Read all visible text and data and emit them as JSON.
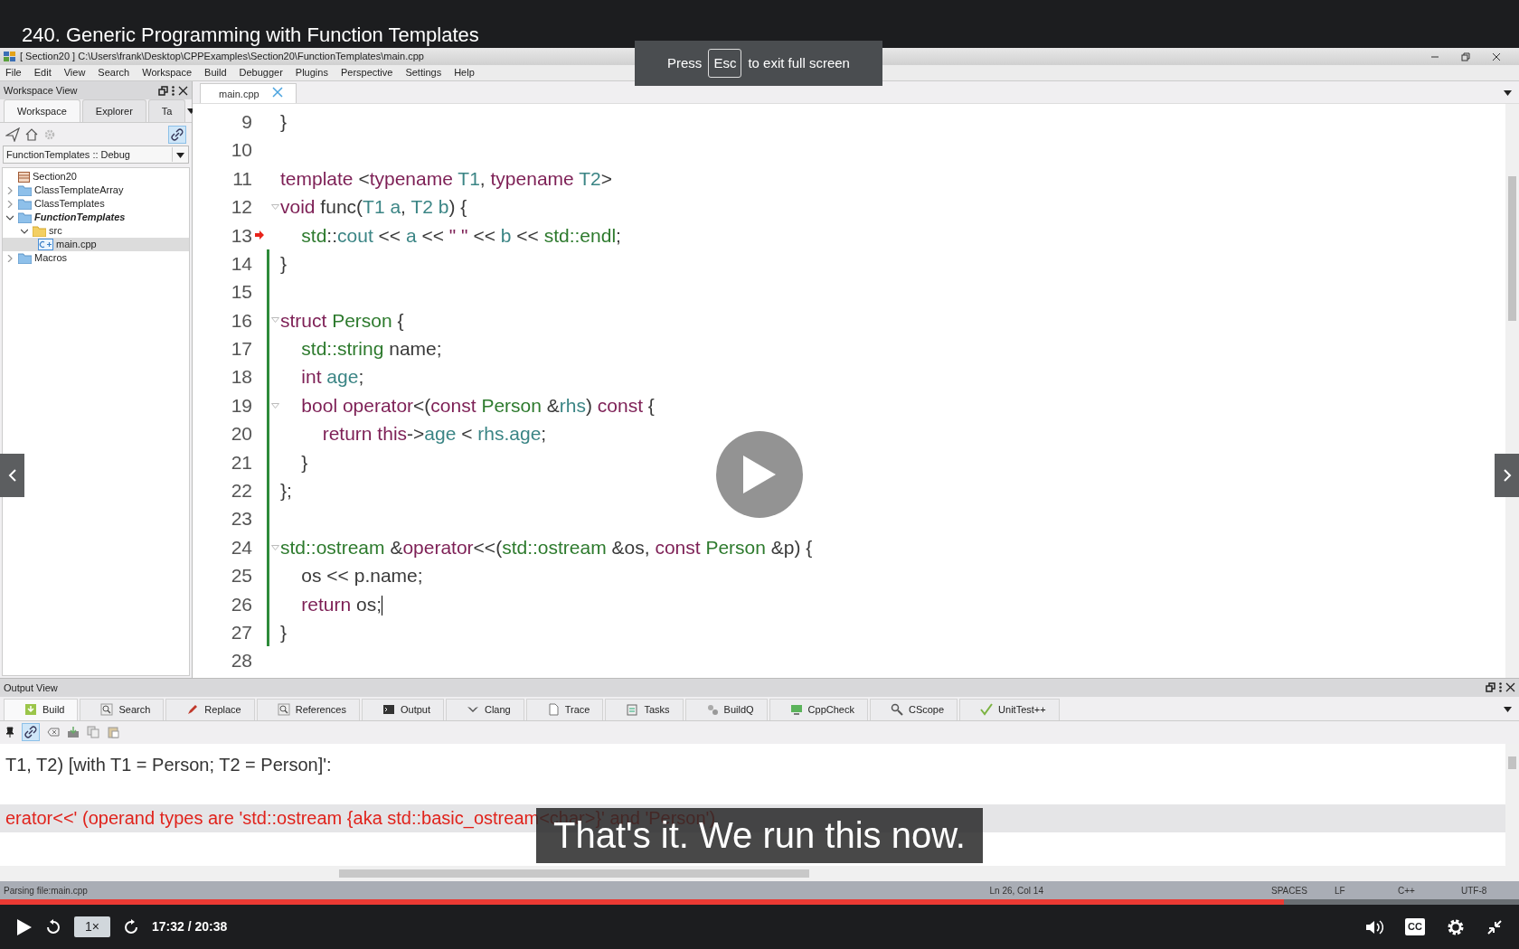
{
  "video": {
    "title": "240. Generic Programming with Function Templates",
    "toast": {
      "before": "Press",
      "key": "Esc",
      "after": "to exit full screen"
    },
    "subtitle": "That's it. We run this now.",
    "progress": {
      "level": 0.845
    },
    "speed": "1×",
    "time": "17:32 / 20:38",
    "captions": "CC"
  },
  "ide": {
    "title": "[ Section20 ] C:\\Users\\frank\\Desktop\\CPPExamples\\Section20\\FunctionTemplates\\main.cpp",
    "menu": [
      "File",
      "Edit",
      "View",
      "Search",
      "Workspace",
      "Build",
      "Debugger",
      "Plugins",
      "Perspective",
      "Settings",
      "Help"
    ],
    "workspace": {
      "title": "Workspace View",
      "tabs": [
        {
          "label": "Workspace",
          "selected": true
        },
        {
          "label": "Explorer",
          "selected": false
        },
        {
          "label": "Ta",
          "selected": false
        }
      ],
      "link_active": true,
      "configuration": "FunctionTemplates :: Debug",
      "tree": [
        {
          "label": "Section20",
          "kind": "workspace",
          "selected": false,
          "active": false,
          "children": [
            {
              "label": "ClassTemplateArray",
              "kind": "project",
              "expanded": false,
              "selected": false,
              "active": false
            },
            {
              "label": "ClassTemplates",
              "kind": "project",
              "expanded": false,
              "selected": false,
              "active": false
            },
            {
              "label": "FunctionTemplates",
              "kind": "project",
              "expanded": true,
              "selected": false,
              "active": true,
              "children": [
                {
                  "label": "src",
                  "kind": "folder",
                  "expanded": true,
                  "selected": false,
                  "active": false,
                  "children": [
                    {
                      "label": "main.cpp",
                      "kind": "file",
                      "selected": true,
                      "active": false
                    }
                  ]
                }
              ]
            },
            {
              "label": "Macros",
              "kind": "project",
              "expanded": false,
              "selected": false,
              "active": false
            }
          ]
        }
      ]
    },
    "editor": {
      "tabs": [
        {
          "label": "main.cpp",
          "selected": true
        }
      ],
      "lines": [
        {
          "number": "9",
          "fold": false,
          "marker": false,
          "modified": false,
          "caret": false,
          "tokens": [
            {
              "t": "}",
              "kind": "p"
            }
          ]
        },
        {
          "number": "10",
          "fold": false,
          "marker": false,
          "modified": false,
          "caret": false
        },
        {
          "number": "11",
          "fold": false,
          "marker": false,
          "modified": false,
          "caret": false,
          "tokens": [
            {
              "t": "template",
              "kind": "kw"
            },
            {
              "t": " <",
              "kind": "p"
            },
            {
              "t": "typename",
              "kind": "kw"
            },
            {
              "t": " T1",
              "kind": "id"
            },
            {
              "t": ", ",
              "kind": "p"
            },
            {
              "t": "typename",
              "kind": "kw"
            },
            {
              "t": " T2",
              "kind": "id"
            },
            {
              "t": ">",
              "kind": "p"
            }
          ]
        },
        {
          "number": "12",
          "fold": true,
          "marker": false,
          "modified": false,
          "caret": false,
          "tokens": [
            {
              "t": "void",
              "kind": "kw"
            },
            {
              "t": " func(",
              "kind": "p"
            },
            {
              "t": "T1 a",
              "kind": "id"
            },
            {
              "t": ", ",
              "kind": "p"
            },
            {
              "t": "T2 b",
              "kind": "id"
            },
            {
              "t": ") {",
              "kind": "p"
            }
          ]
        },
        {
          "number": "13",
          "fold": false,
          "marker": true,
          "modified": false,
          "caret": false,
          "tokens": [
            {
              "t": "    std",
              "kind": "ns"
            },
            {
              "t": "::",
              "kind": "p"
            },
            {
              "t": "cout",
              "kind": "id"
            },
            {
              "t": " << ",
              "kind": "p"
            },
            {
              "t": "a",
              "kind": "id"
            },
            {
              "t": " << ",
              "kind": "p"
            },
            {
              "t": "\" \"",
              "kind": "str"
            },
            {
              "t": " << ",
              "kind": "p"
            },
            {
              "t": "b",
              "kind": "id"
            },
            {
              "t": " << ",
              "kind": "p"
            },
            {
              "t": "std::endl",
              "kind": "ns"
            },
            {
              "t": ";",
              "kind": "p"
            }
          ]
        },
        {
          "number": "14",
          "fold": false,
          "marker": false,
          "modified": true,
          "caret": false,
          "tokens": [
            {
              "t": "}",
              "kind": "p"
            }
          ]
        },
        {
          "number": "15",
          "fold": false,
          "marker": false,
          "modified": true,
          "caret": false
        },
        {
          "number": "16",
          "fold": true,
          "marker": false,
          "modified": true,
          "caret": false,
          "tokens": [
            {
              "t": "struct",
              "kind": "kw"
            },
            {
              "t": " Person",
              "kind": "ns"
            },
            {
              "t": " {",
              "kind": "p"
            }
          ]
        },
        {
          "number": "17",
          "fold": false,
          "marker": false,
          "modified": true,
          "caret": false,
          "tokens": [
            {
              "t": "    std::string",
              "kind": "ns"
            },
            {
              "t": " name;",
              "kind": "p"
            }
          ]
        },
        {
          "number": "18",
          "fold": false,
          "marker": false,
          "modified": true,
          "caret": false,
          "tokens": [
            {
              "t": "    int",
              "kind": "kw"
            },
            {
              "t": " age",
              "kind": "id"
            },
            {
              "t": ";",
              "kind": "p"
            }
          ]
        },
        {
          "number": "19",
          "fold": true,
          "marker": false,
          "modified": true,
          "caret": false,
          "tokens": [
            {
              "t": "    bool operator",
              "kind": "kw"
            },
            {
              "t": "<(",
              "kind": "p"
            },
            {
              "t": "const",
              "kind": "kw"
            },
            {
              "t": " Person",
              "kind": "ns"
            },
            {
              "t": " &",
              "kind": "p"
            },
            {
              "t": "rhs",
              "kind": "id"
            },
            {
              "t": ") ",
              "kind": "p"
            },
            {
              "t": "const",
              "kind": "kw"
            },
            {
              "t": " {",
              "kind": "p"
            }
          ]
        },
        {
          "number": "20",
          "fold": false,
          "marker": false,
          "modified": true,
          "caret": false,
          "tokens": [
            {
              "t": "        return this",
              "kind": "kw"
            },
            {
              "t": "->",
              "kind": "p"
            },
            {
              "t": "age",
              "kind": "id"
            },
            {
              "t": " < ",
              "kind": "p"
            },
            {
              "t": "rhs.age",
              "kind": "id"
            },
            {
              "t": ";",
              "kind": "p"
            }
          ]
        },
        {
          "number": "21",
          "fold": false,
          "marker": false,
          "modified": true,
          "caret": false,
          "tokens": [
            {
              "t": "    }",
              "kind": "p"
            }
          ]
        },
        {
          "number": "22",
          "fold": false,
          "marker": false,
          "modified": true,
          "caret": false,
          "tokens": [
            {
              "t": "};",
              "kind": "p"
            }
          ]
        },
        {
          "number": "23",
          "fold": false,
          "marker": false,
          "modified": true,
          "caret": false
        },
        {
          "number": "24",
          "fold": true,
          "marker": false,
          "modified": true,
          "caret": false,
          "tokens": [
            {
              "t": "std::ostream",
              "kind": "ns"
            },
            {
              "t": " &",
              "kind": "p"
            },
            {
              "t": "operator",
              "kind": "kw"
            },
            {
              "t": "<<(",
              "kind": "p"
            },
            {
              "t": "std::ostream",
              "kind": "ns"
            },
            {
              "t": " &os, ",
              "kind": "p"
            },
            {
              "t": "const",
              "kind": "kw"
            },
            {
              "t": " Person",
              "kind": "ns"
            },
            {
              "t": " &p) {",
              "kind": "p"
            }
          ]
        },
        {
          "number": "25",
          "fold": false,
          "marker": false,
          "modified": true,
          "caret": false,
          "tokens": [
            {
              "t": "    os << p.name;",
              "kind": "p"
            }
          ]
        },
        {
          "number": "26",
          "fold": false,
          "marker": false,
          "modified": true,
          "caret": true,
          "tokens": [
            {
              "t": "    return",
              "kind": "kw"
            },
            {
              "t": " os;",
              "kind": "p"
            }
          ]
        },
        {
          "number": "27",
          "fold": false,
          "marker": false,
          "modified": true,
          "caret": false,
          "tokens": [
            {
              "t": "}",
              "kind": "p"
            }
          ]
        },
        {
          "number": "28",
          "fold": false,
          "marker": false,
          "modified": false,
          "caret": false
        }
      ]
    },
    "output": {
      "title": "Output View",
      "tabs": [
        {
          "label": "Build",
          "selected": true
        },
        {
          "label": "Search",
          "selected": false
        },
        {
          "label": "Replace",
          "selected": false
        },
        {
          "label": "References",
          "selected": false
        },
        {
          "label": "Output",
          "selected": false
        },
        {
          "label": "Clang",
          "selected": false
        },
        {
          "label": "Trace",
          "selected": false
        },
        {
          "label": "Tasks",
          "selected": false
        },
        {
          "label": "BuildQ",
          "selected": false
        },
        {
          "label": "CppCheck",
          "selected": false
        },
        {
          "label": "CScope",
          "selected": false
        },
        {
          "label": "UnitTest++",
          "selected": false
        }
      ],
      "link_active": true,
      "lines": [
        {
          "text": "T1, T2) [with T1 = Person; T2 = Person]':",
          "kind": "note",
          "selected": false
        },
        {
          "text": "erator<<' (operand types are 'std::ostream {aka std::basic_ostream<char>}' and 'Person')",
          "kind": "error",
          "selected": true
        }
      ]
    },
    "status_bar": {
      "message": "Parsing file:main.cpp",
      "position": "Ln 26, Col 14",
      "indent": "SPACES",
      "line_ending": "LF",
      "language": "C++",
      "encoding": "UTF-8"
    }
  }
}
